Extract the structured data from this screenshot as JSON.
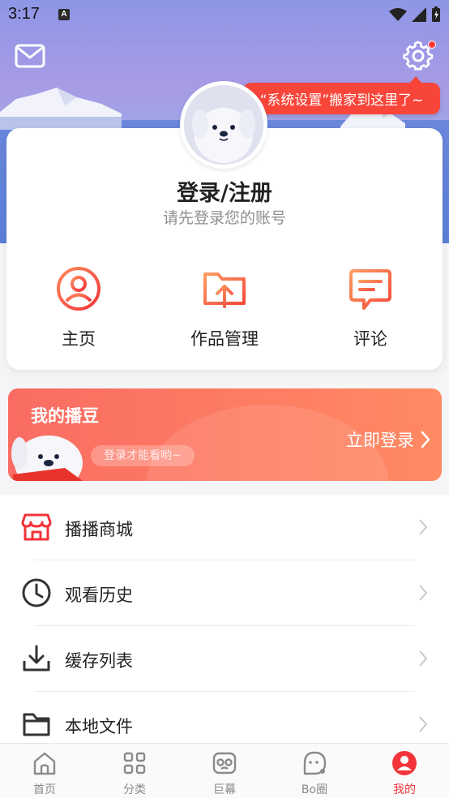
{
  "status_bar": {
    "time": "3:17",
    "notification_letter": "A"
  },
  "header": {
    "settings_tip": "“系统设置”搬家到这里了~"
  },
  "profile": {
    "title": "登录/注册",
    "subtitle": "请先登录您的账号"
  },
  "quick_actions": [
    {
      "label": "主页",
      "icon": "user-circle-icon"
    },
    {
      "label": "作品管理",
      "icon": "folder-upload-icon"
    },
    {
      "label": "评论",
      "icon": "comment-icon"
    }
  ],
  "banner": {
    "title": "我的播豆",
    "pill": "登录才能看哟~",
    "cta": "立即登录"
  },
  "menu": [
    {
      "label": "播播商城",
      "icon": "shop-icon"
    },
    {
      "label": "观看历史",
      "icon": "clock-icon"
    },
    {
      "label": "缓存列表",
      "icon": "download-icon"
    },
    {
      "label": "本地文件",
      "icon": "folder-icon"
    }
  ],
  "tabs": [
    {
      "label": "首页",
      "icon": "home-icon",
      "active": false
    },
    {
      "label": "分类",
      "icon": "grid-icon",
      "active": false
    },
    {
      "label": "巨幕",
      "icon": "vr-icon",
      "active": false
    },
    {
      "label": "Bo圈",
      "icon": "chat-bubble-icon",
      "active": false
    },
    {
      "label": "我的",
      "icon": "profile-icon",
      "active": true
    }
  ],
  "colors": {
    "accent": "#f2343a",
    "banner_start": "#fa6c63",
    "banner_end": "#ff8a63",
    "tip": "#f8453a"
  }
}
